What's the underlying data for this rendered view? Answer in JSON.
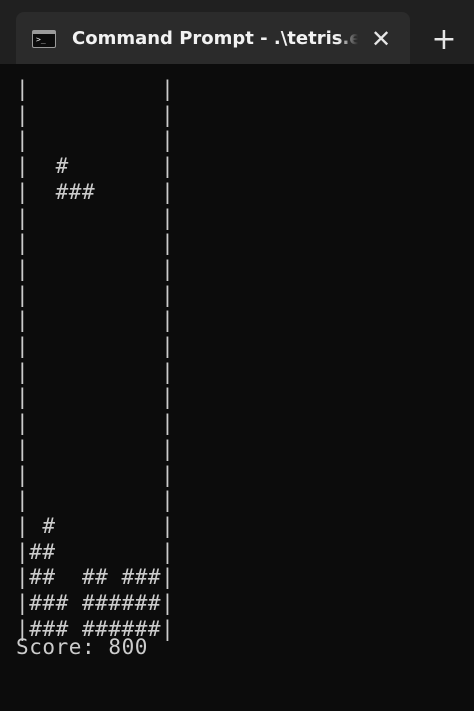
{
  "tab": {
    "title": "Command Prompt - .\\tetris.exe",
    "icon": "terminal-icon",
    "icon_glyph": ">_",
    "close_glyph": "✕",
    "close_icon": "close-icon",
    "new_tab_glyph": "+",
    "new_tab_icon": "plus-icon"
  },
  "terminal": {
    "board": "|          |\n|          |\n|          |\n|  #       |\n|  ###     |\n|          |\n|          |\n|          |\n|          |\n|          |\n|          |\n|          |\n|          |\n|          |\n|          |\n|          |\n|          |\n| #        |\n|##        |\n|##  ## ###|\n|### ######|\n|### ######|",
    "score_label": "Score:",
    "score_value": "800"
  },
  "colors": {
    "tabbar_bg": "#202020",
    "active_tab_bg": "#2b2b2b",
    "terminal_bg": "#0c0c0c",
    "terminal_text": "#cccccc"
  }
}
